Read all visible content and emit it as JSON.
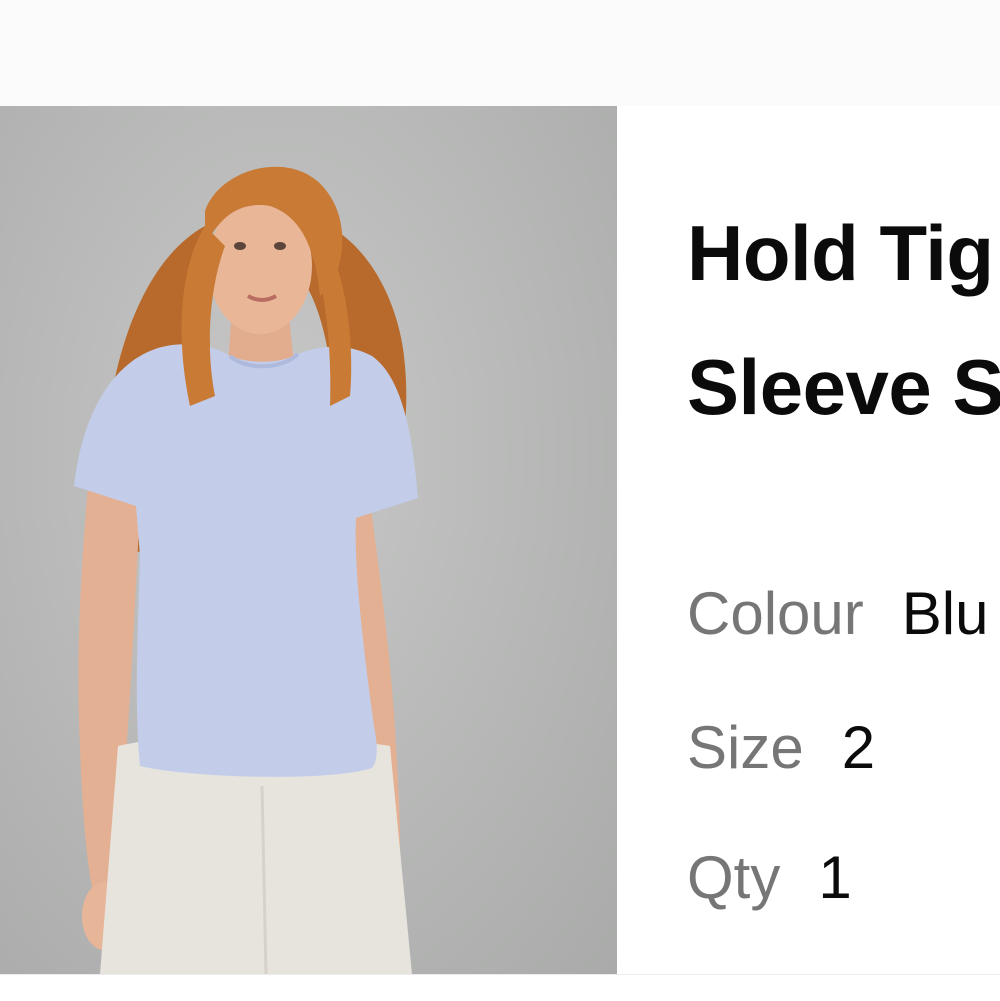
{
  "product": {
    "title_line1": "Hold Tig",
    "title_line2": "Sleeve S",
    "image_alt": "Woman with curly red hair wearing a light blue ribbed short-sleeve top and white pants"
  },
  "attributes": [
    {
      "label": "Colour",
      "value": "Blu"
    },
    {
      "label": "Size",
      "value": "2"
    },
    {
      "label": "Qty",
      "value": "1"
    }
  ],
  "colors": {
    "shirt": "#c3cdea",
    "hair": "#c97a35",
    "background": "#b9bab9",
    "pants": "#e7e4dd"
  }
}
